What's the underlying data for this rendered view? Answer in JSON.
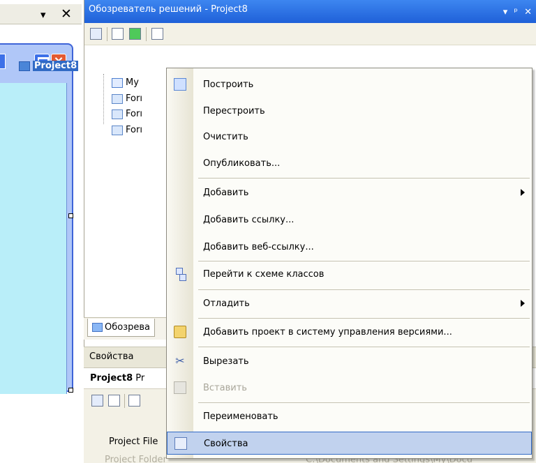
{
  "left_pane": {
    "pin_glyph": "▾",
    "close_glyph": "✕"
  },
  "solution_explorer": {
    "title": "Обозреватель решений - Project8",
    "title_pin_glyph": "▾",
    "title_dock_glyph": "ᵖ",
    "title_close_glyph": "✕",
    "project_name": "Project8",
    "tree_items": [
      "My",
      "Forı",
      "Forı",
      "Forı"
    ],
    "tab_label": "Обозрева"
  },
  "properties": {
    "title": "Свойства",
    "object_name": "Project8",
    "object_type": "Pr",
    "rows": [
      "Project File",
      "Project Folder"
    ],
    "folder_value": "C:\\Documents and Settings\\My\\Docu"
  },
  "context_menu": {
    "items": [
      {
        "label": "Построить",
        "icon": "build-icon",
        "submenu": false,
        "disabled": false
      },
      {
        "label": "Перестроить",
        "icon": null,
        "submenu": false,
        "disabled": false
      },
      {
        "label": "Очистить",
        "icon": null,
        "submenu": false,
        "disabled": false
      },
      {
        "label": "Опубликовать...",
        "icon": null,
        "submenu": false,
        "disabled": false
      },
      {
        "label": "Добавить",
        "icon": null,
        "submenu": true,
        "disabled": false
      },
      {
        "label": "Добавить ссылку...",
        "icon": null,
        "submenu": false,
        "disabled": false
      },
      {
        "label": "Добавить веб-ссылку...",
        "icon": null,
        "submenu": false,
        "disabled": false
      },
      {
        "label": "Перейти к схеме классов",
        "icon": "class-diagram-icon",
        "submenu": false,
        "disabled": false
      },
      {
        "label": "Отладить",
        "icon": null,
        "submenu": true,
        "disabled": false
      },
      {
        "label": "Добавить проект в систему управления версиями...",
        "icon": "add-project-icon",
        "submenu": false,
        "disabled": false
      },
      {
        "label": "Вырезать",
        "icon": "cut-icon",
        "submenu": false,
        "disabled": false
      },
      {
        "label": "Вставить",
        "icon": "paste-icon",
        "submenu": false,
        "disabled": true
      },
      {
        "label": "Переименовать",
        "icon": null,
        "submenu": false,
        "disabled": false
      },
      {
        "label": "Свойства",
        "icon": "properties-icon",
        "submenu": false,
        "disabled": false,
        "selected": true
      }
    ]
  }
}
